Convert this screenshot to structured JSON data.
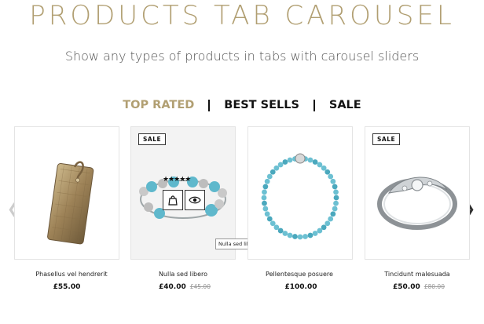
{
  "header": {
    "title": "PRODUCTS TAB CAROUSEL",
    "subtitle": "Show any types of products in tabs with carousel sliders"
  },
  "tabs": [
    {
      "label": "TOP RATED",
      "active": true
    },
    {
      "label": "BEST SELLS",
      "active": false
    },
    {
      "label": "SALE",
      "active": false
    }
  ],
  "products": [
    {
      "name": "Phasellus vel hendrerit",
      "price": "£55.00",
      "old_price": "",
      "badge": "",
      "image": "gold-clutch-wallet"
    },
    {
      "name": "Nulla sed libero",
      "price": "£40.00",
      "old_price": "£45.00",
      "badge": "SALE",
      "image": "turquoise-charm-bracelet",
      "rating": "★★★★★",
      "tooltip": "Nulla sed libero"
    },
    {
      "name": "Pellentesque posuere",
      "price": "£100.00",
      "old_price": "",
      "badge": "",
      "image": "turquoise-bead-bracelet"
    },
    {
      "name": "Tincidunt malesuada",
      "price": "£50.00",
      "old_price": "£80.00",
      "badge": "SALE",
      "image": "silver-swirl-ring"
    }
  ],
  "colors": {
    "accent": "#b19f72",
    "turquoise": "#5fb8cc",
    "gold": "#a88a5a"
  },
  "icons": {
    "prev": "chevron-left-icon",
    "next": "chevron-right-icon",
    "cart": "shopping-bag-icon",
    "quickview": "eye-icon"
  }
}
